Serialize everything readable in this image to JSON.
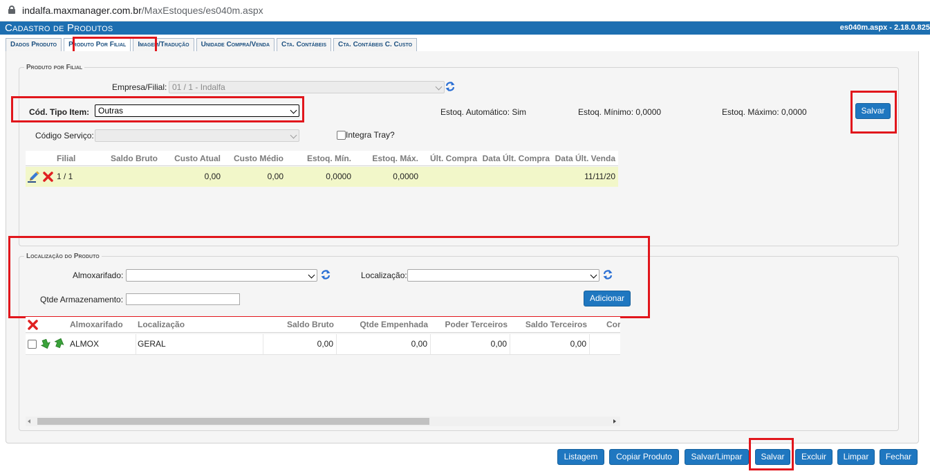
{
  "browser": {
    "url_host": "indalfa.maxmanager.com.br",
    "url_path": "/MaxEstoques/es040m.aspx"
  },
  "app": {
    "title": "Cadastro de Produtos",
    "version": "es040m.aspx - 2.18.0.825"
  },
  "tabs": [
    {
      "label": "Dados Produto"
    },
    {
      "label": "Produto Por Filial",
      "active": true
    },
    {
      "label": "Imagem/Tradução"
    },
    {
      "label": "Unidade Compra/Venda"
    },
    {
      "label": "Cta. Contábeis"
    },
    {
      "label": "Cta. Contábeis C. Custo"
    }
  ],
  "filial_section": {
    "legend": "Produto por Filial",
    "empresa_label": "Empresa/Filial:",
    "empresa_value": "01 / 1 - Indalfa",
    "tipo_item_label": "Cód. Tipo Item:",
    "tipo_item_value": "Outras",
    "estoq_auto": "Estoq. Automático: Sim",
    "estoq_min": "Estoq. Mínimo: 0,0000",
    "estoq_max": "Estoq. Máximo: 0,0000",
    "salvar_label": "Salvar",
    "codigo_servico_label": "Código Serviço:",
    "codigo_servico_value": "",
    "integra_tray_label": "Integra Tray?"
  },
  "grid1": {
    "headers": [
      "Filial",
      "Saldo Bruto",
      "Custo Atual",
      "Custo Médio",
      "Estoq. Mín.",
      "Estoq. Máx.",
      "Últ. Compra",
      "Data Últ. Compra",
      "Data Últ. Venda"
    ],
    "row": {
      "filial": "1 / 1",
      "saldo_bruto": "",
      "custo_atual": "0,00",
      "custo_medio": "0,00",
      "estoq_min": "0,0000",
      "estoq_max": "0,0000",
      "ult_compra": "",
      "data_ult_compra": "",
      "data_ult_venda": "11/11/20"
    }
  },
  "localizacao_section": {
    "legend": "Localização do Produto",
    "almoxarifado_label": "Almoxarifado:",
    "almoxarifado_value": "",
    "localizacao_label": "Localização:",
    "localizacao_value": "",
    "qtde_label": "Qtde Armazenamento:",
    "qtde_value": "",
    "adicionar_label": "Adicionar"
  },
  "grid2": {
    "headers": [
      "Almoxarifado",
      "Localização",
      "Saldo Bruto",
      "Qtde Empenhada",
      "Poder Terceiros",
      "Saldo Terceiros",
      "Cor"
    ],
    "row": {
      "almoxarifado": "ALMOX",
      "localizacao": "GERAL",
      "saldo_bruto": "0,00",
      "qtde_empenhada": "0,00",
      "poder_terceiros": "0,00",
      "saldo_terceiros": "0,00"
    }
  },
  "footer_buttons": {
    "listagem": "Listagem",
    "copiar": "Copiar Produto",
    "salvar_limpar": "Salvar/Limpar",
    "salvar": "Salvar",
    "excluir": "Excluir",
    "limpar": "Limpar",
    "fechar": "Fechar"
  },
  "colors": {
    "brand_blue": "#1d6fb1",
    "button_blue": "#1f77c0",
    "highlight_red": "#e1161c",
    "row_highlight": "#f2f7c9"
  },
  "icons": [
    "lock-icon",
    "refresh-icon",
    "edit-icon",
    "delete-icon",
    "arrow-down-icon",
    "arrow-up-icon",
    "chevron-down-icon"
  ]
}
